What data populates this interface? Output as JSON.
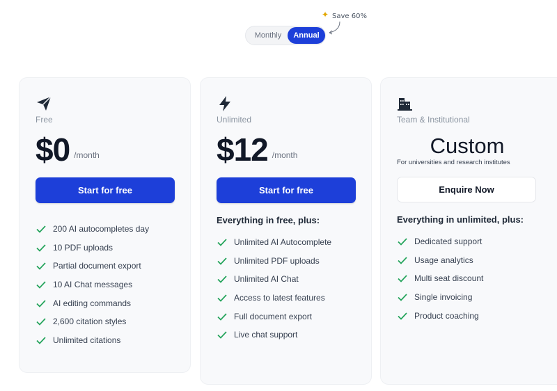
{
  "billing_toggle": {
    "monthly_label": "Monthly",
    "annual_label": "Annual",
    "selected": "Annual"
  },
  "save_note": {
    "icon": "bee-icon",
    "text": "Save 60%"
  },
  "colors": {
    "accent": "#1d3fd9",
    "check": "#22a35a",
    "card_bg": "#f8f9fb"
  },
  "plans": {
    "free": {
      "icon": "paper-plane-icon",
      "name": "Free",
      "price": "$0",
      "period": "/month",
      "cta": "Start for free",
      "features": [
        "200 AI autocompletes day",
        "10 PDF uploads",
        "Partial document export",
        "10 AI Chat messages",
        "AI editing commands",
        "2,600 citation styles",
        "Unlimited citations"
      ]
    },
    "unlimited": {
      "icon": "lightning-icon",
      "name": "Unlimited",
      "price": "$12",
      "period": "/month",
      "cta": "Start for free",
      "features_heading": "Everything in free, plus:",
      "features": [
        "Unlimited AI Autocomplete",
        "Unlimited PDF uploads",
        "Unlimited AI Chat",
        "Access to latest features",
        "Full document export",
        "Live chat support"
      ]
    },
    "team": {
      "icon": "building-icon",
      "name": "Team & Institutional",
      "price": "Custom",
      "subtitle": "For universities and research institutes",
      "cta": "Enquire Now",
      "features_heading": "Everything in unlimited, plus:",
      "features": [
        "Dedicated support",
        "Usage analytics",
        "Multi seat discount",
        "Single invoicing",
        "Product coaching"
      ]
    }
  }
}
